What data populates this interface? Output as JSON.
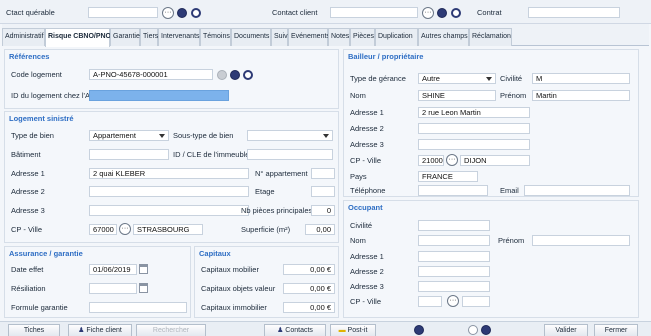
{
  "header": {
    "ctact_label": "Ctact quérable",
    "contact_client_label": "Contact client",
    "contrat_label": "Contrat"
  },
  "tabs": [
    "Administratif",
    "Risque CBNO/PNO",
    "Garanties",
    "Tiers",
    "Intervenants",
    "Témoins",
    "Documents",
    "Suivi",
    "Evénements",
    "Notes",
    "Pièces",
    "Duplication",
    "Autres champs",
    "Réclamation"
  ],
  "references": {
    "title": "Références",
    "code_logement_label": "Code logement",
    "code_logement_value": "A-PNO-45678-000001",
    "id_logement_label": "ID du logement chez l'ADB",
    "id_logement_value": ""
  },
  "logement": {
    "title": "Logement sinistré",
    "type_bien_label": "Type de bien",
    "type_bien_value": "Appartement",
    "sous_type_label": "Sous-type de bien",
    "sous_type_value": "",
    "batiment_label": "Bâtiment",
    "id_cle_label": "ID / CLE de l'immeuble",
    "adresse1_label": "Adresse 1",
    "adresse1_value": "2 quai KLEBER",
    "appartement_label": "N° appartement",
    "adresse2_label": "Adresse 2",
    "etage_label": "Etage",
    "adresse3_label": "Adresse 3",
    "nb_pieces_label": "Nb pièces principales",
    "nb_pieces_value": "0",
    "cp_ville_label": "CP - Ville",
    "cp_value": "67000",
    "ville_value": "STRASBOURG",
    "superficie_label": "Superficie (m²)",
    "superficie_value": "0,00"
  },
  "assurance": {
    "title": "Assurance / garantie",
    "date_effet_label": "Date effet",
    "date_effet_value": "01/06/2019",
    "resiliation_label": "Résiliation",
    "formule_label": "Formule garantie"
  },
  "capitaux": {
    "title": "Capitaux",
    "mobilier_label": "Capitaux mobilier",
    "mobilier_value": "0,00 €",
    "objets_label": "Capitaux objets valeur",
    "objets_value": "0,00 €",
    "immobilier_label": "Capitaux immobilier",
    "immobilier_value": "0,00 €"
  },
  "bailleur": {
    "title": "Bailleur / propriétaire",
    "type_gerance_label": "Type de gérance",
    "type_gerance_value": "Autre",
    "civilite_label": "Civilité",
    "civilite_value": "M",
    "nom_label": "Nom",
    "nom_value": "SHINE",
    "prenom_label": "Prénom",
    "prenom_value": "Martin",
    "adresse1_label": "Adresse 1",
    "adresse1_value": "2 rue Leon Martin",
    "adresse2_label": "Adresse 2",
    "adresse3_label": "Adresse 3",
    "cp_ville_label": "CP - Ville",
    "cp_value": "21000",
    "ville_value": "DIJON",
    "pays_label": "Pays",
    "pays_value": "FRANCE",
    "telephone_label": "Téléphone",
    "email_label": "Email"
  },
  "occupant": {
    "title": "Occupant",
    "civilite_label": "Civilité",
    "nom_label": "Nom",
    "prenom_label": "Prénom",
    "adresse1_label": "Adresse 1",
    "adresse2_label": "Adresse 2",
    "adresse3_label": "Adresse 3",
    "cp_ville_label": "CP - Ville"
  },
  "footer": {
    "tiches_label": "Tiches",
    "fiche_client_label": "Fiche client",
    "disabled_label": "Rechercher",
    "contacts_label": "Contacts",
    "postit_label": "Post-it",
    "valider_label": "Valider",
    "fermer_label": "Fermer"
  },
  "colors": {
    "section_title": "#2e6ec4",
    "highlight_field": "#7cb2ec",
    "icon_navy": "#2d3a75"
  }
}
